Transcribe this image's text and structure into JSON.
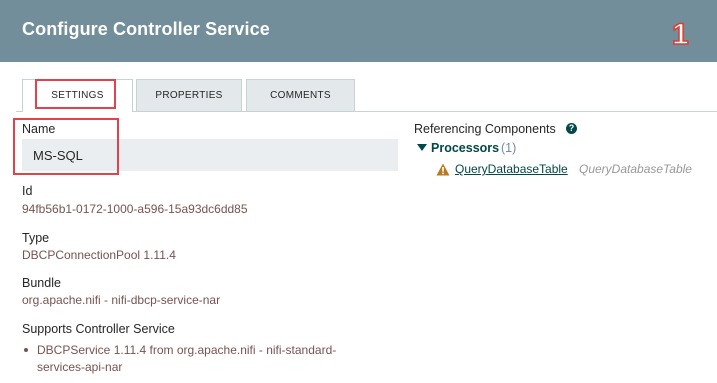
{
  "dialog": {
    "title": "Configure Controller Service",
    "step_marker": "1"
  },
  "tabs": [
    {
      "label": "SETTINGS",
      "active": true
    },
    {
      "label": "PROPERTIES",
      "active": false
    },
    {
      "label": "COMMENTS",
      "active": false
    }
  ],
  "settings": {
    "name_label": "Name",
    "name_value": "MS-SQL",
    "id_label": "Id",
    "id_value": "94fb56b1-0172-1000-a596-15a93dc6dd85",
    "type_label": "Type",
    "type_value": "DBCPConnectionPool 1.11.4",
    "bundle_label": "Bundle",
    "bundle_value": "org.apache.nifi - nifi-dbcp-service-nar",
    "supports_label": "Supports Controller Service",
    "supports_items": [
      "DBCPService 1.11.4 from org.apache.nifi - nifi-standard-services-api-nar"
    ]
  },
  "referencing": {
    "label": "Referencing Components",
    "help_icon": "help-icon",
    "group_title": "Processors",
    "group_count": "(1)",
    "items": [
      {
        "name": "QueryDatabaseTable",
        "type": "QueryDatabaseTable",
        "icon": "warning-icon"
      }
    ]
  },
  "colors": {
    "header_bg": "#728e9b",
    "value_text": "#775351",
    "link": "#004849",
    "highlight": "#e0434c",
    "warning": "#ba7a1e"
  }
}
